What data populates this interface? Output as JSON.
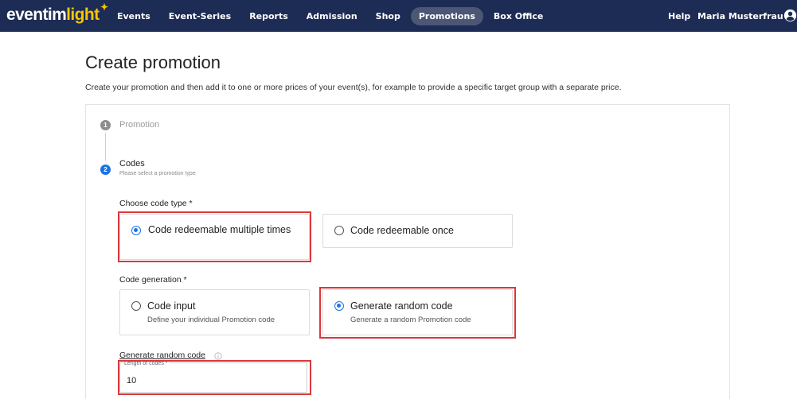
{
  "brand": {
    "logo_main": "eventim",
    "logo_accent": "light",
    "logo_star": "✦"
  },
  "nav": {
    "items": [
      {
        "label": "Events",
        "active": false
      },
      {
        "label": "Event-Series",
        "active": false
      },
      {
        "label": "Reports",
        "active": false
      },
      {
        "label": "Admission",
        "active": false
      },
      {
        "label": "Shop",
        "active": false
      },
      {
        "label": "Promotions",
        "active": true
      },
      {
        "label": "Box Office",
        "active": false
      }
    ],
    "help": "Help",
    "user_name": "Maria Musterfrau"
  },
  "page": {
    "title": "Create promotion",
    "description": "Create your promotion and then add it to one or more prices of your event(s), for example to provide a specific target group with a separate price."
  },
  "stepper": {
    "step1": {
      "number": "1",
      "label": "Promotion"
    },
    "step2": {
      "number": "2",
      "label": "Codes",
      "sublabel": "Please select a promotion type"
    }
  },
  "code_type": {
    "label": "Choose code type *",
    "options": [
      {
        "title": "Code redeemable multiple times",
        "selected": true
      },
      {
        "title": "Code redeemable once",
        "selected": false
      }
    ]
  },
  "code_generation": {
    "label": "Code generation *",
    "options": [
      {
        "title": "Code input",
        "subtitle": "Define your individual Promotion code",
        "selected": false
      },
      {
        "title": "Generate random code",
        "subtitle": "Generate a random Promotion code",
        "selected": true
      }
    ]
  },
  "random_code": {
    "label": "Generate random code",
    "length_field": {
      "legend": "Length of codes *",
      "value": "10"
    }
  },
  "colors": {
    "nav_bg": "#1d2c55",
    "nav_active": "#4c5675",
    "logo_accent": "#f6c600",
    "primary": "#1a73e8",
    "highlight": "#d9383c"
  }
}
